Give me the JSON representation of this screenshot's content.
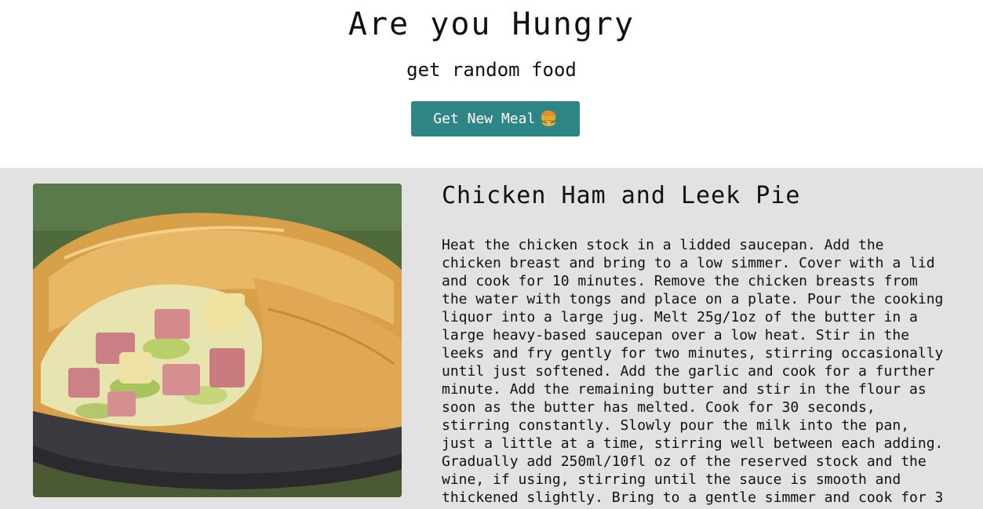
{
  "header": {
    "title": "Are you Hungry",
    "subtitle": "get random food",
    "button_label": "Get New Meal",
    "button_icon": "🍔",
    "button_color": "#2e8585"
  },
  "meal": {
    "image_icon": "pie-photo",
    "name": "Chicken Ham and Leek Pie",
    "instructions": "Heat the chicken stock in a lidded saucepan. Add the\nchicken breast and bring to a low simmer. Cover with a lid\nand cook for 10 minutes. Remove the chicken breasts from\nthe water with tongs and place on a plate. Pour the cooking\nliquor into a large jug. Melt 25g/1oz of the butter in a\nlarge heavy-based saucepan over a low heat. Stir in the\nleeks and fry gently for two minutes, stirring occasionally\nuntil just softened. Add the garlic and cook for a further\nminute. Add the remaining butter and stir in the flour as\nsoon as the butter has melted. Cook for 30 seconds,\nstirring constantly. Slowly pour the milk into the pan,\njust a little at a time, stirring well between each adding.\nGradually add 250ml/10fl oz of the reserved stock and the\nwine, if using, stirring until the sauce is smooth and\nthickened slightly. Bring to a gentle simmer and cook for 3"
  },
  "colors": {
    "section_background": "#e2e2e2"
  }
}
